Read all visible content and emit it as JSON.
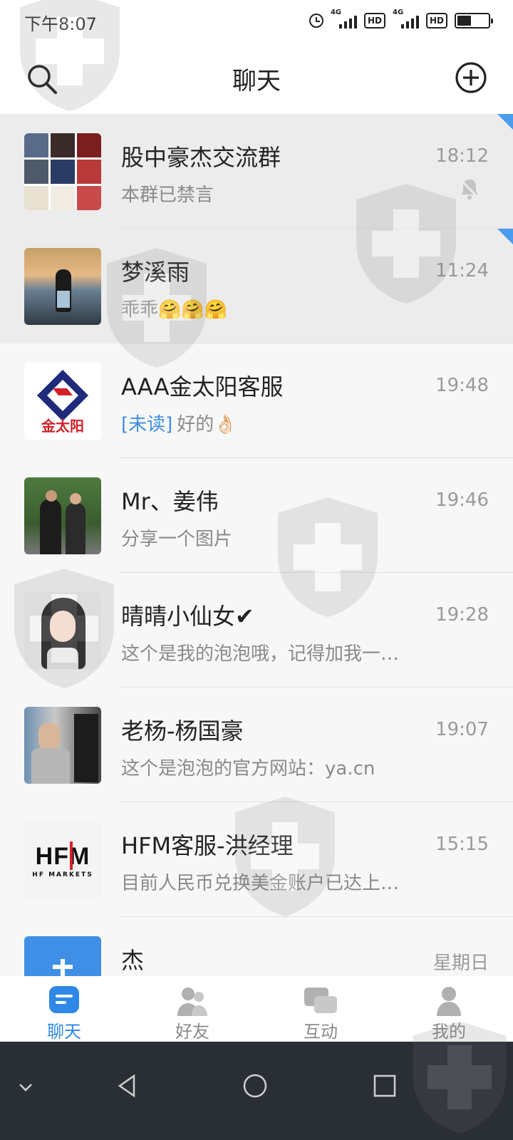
{
  "status_bar": {
    "time": "下午8:07",
    "net1": "4G",
    "net2": "4G",
    "hd1": "HD",
    "hd2": "HD",
    "battery_level": 0.45
  },
  "header": {
    "title": "聊天"
  },
  "chats": [
    {
      "name": "股中豪杰交流群",
      "preview": "本群已禁言",
      "time": "18:12",
      "pinned": true,
      "muted": true
    },
    {
      "name": "梦溪雨",
      "preview": "乖乖🤗🤗🤗",
      "time": "11:24",
      "pinned": true
    },
    {
      "name": "AAA金太阳客服",
      "unread_tag": "[未读]",
      "preview": "好的👌🏻",
      "time": "19:48",
      "avatar_text": "金太阳"
    },
    {
      "name": "Mr、姜伟",
      "preview": "分享一个图片",
      "time": "19:46"
    },
    {
      "name": "晴晴小仙女✔",
      "preview": "这个是我的泡泡哦，记得加我一…",
      "time": "19:28"
    },
    {
      "name": "老杨-杨国豪",
      "preview": "这个是泡泡的官方网站：ya.cn",
      "time": "19:07"
    },
    {
      "name": "HFM客服-洪经理",
      "preview": "目前人民币兑换美金账户已达上…",
      "time": "15:15",
      "avatar_text": "HFM",
      "avatar_subtext": "HF MARKETS"
    },
    {
      "name": "杰",
      "preview": "",
      "time": "星期日"
    }
  ],
  "tabs": [
    {
      "label": "聊天",
      "icon": "chat-icon",
      "active": true
    },
    {
      "label": "好友",
      "icon": "friends-icon",
      "active": false
    },
    {
      "label": "互动",
      "icon": "interact-icon",
      "active": false
    },
    {
      "label": "我的",
      "icon": "profile-icon",
      "active": false
    }
  ],
  "colors": {
    "accent": "#2f87e6",
    "unread": "#3e8ee5",
    "pin": "#4a9cf0",
    "navbar": "#2a2e35"
  }
}
